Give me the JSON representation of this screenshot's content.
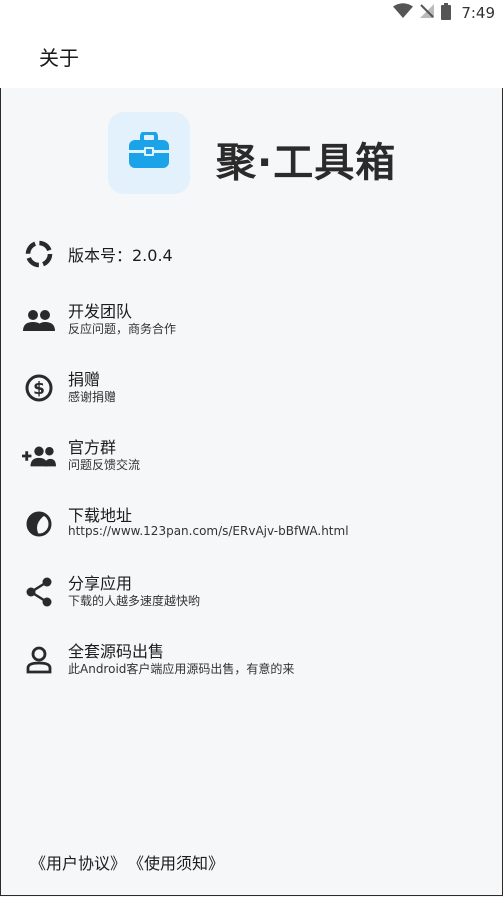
{
  "status_bar": {
    "time": "7:49",
    "icons": [
      "wifi-icon",
      "no-signal-icon",
      "battery-icon"
    ]
  },
  "app_bar": {
    "title": "关于"
  },
  "hero": {
    "app_name": "聚·工具箱",
    "logo_icon": "toolbox-icon",
    "accent_color": "#1aa3e8"
  },
  "menu": {
    "items": [
      {
        "icon": "version-ring-icon",
        "title": "版本号：2.0.4",
        "subtitle": ""
      },
      {
        "icon": "team-icon",
        "title": "开发团队",
        "subtitle": "反应问题，商务合作"
      },
      {
        "icon": "dollar-coin-icon",
        "title": "捐赠",
        "subtitle": "感谢捐赠"
      },
      {
        "icon": "group-add-icon",
        "title": "官方群",
        "subtitle": "问题反馈交流"
      },
      {
        "icon": "contrast-icon",
        "title": "下载地址",
        "subtitle": "https://www.123pan.com/s/ERvAjv-bBfWA.html"
      },
      {
        "icon": "share-icon",
        "title": "分享应用",
        "subtitle": "下载的人越多速度越快哟"
      },
      {
        "icon": "person-icon",
        "title": "全套源码出售",
        "subtitle": "此Android客户端应用源码出售，有意的来"
      }
    ]
  },
  "footer": {
    "user_agreement": "《用户协议》",
    "usage_notice": "《使用须知》"
  }
}
